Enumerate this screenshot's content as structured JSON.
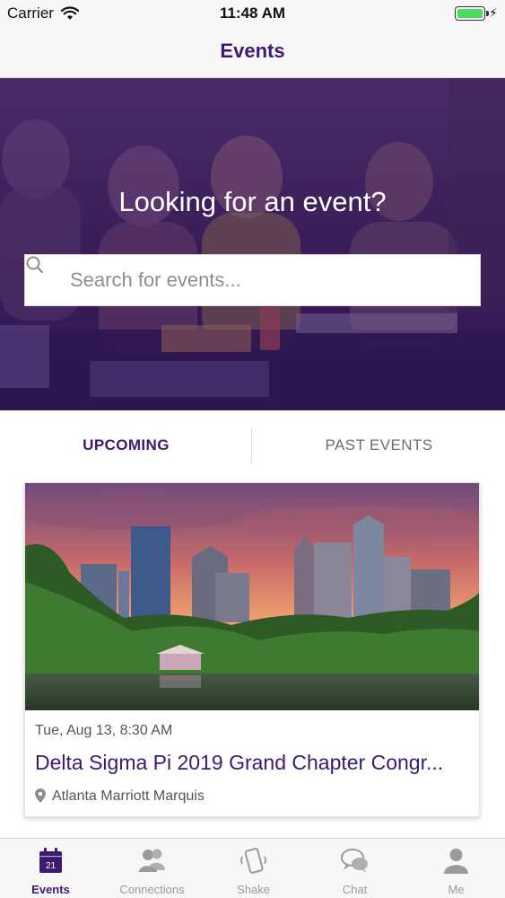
{
  "status_bar": {
    "carrier": "Carrier",
    "time": "11:48 AM",
    "battery_level": 1.0
  },
  "nav": {
    "title": "Events"
  },
  "hero": {
    "heading": "Looking for an event?"
  },
  "search": {
    "placeholder": "Search for events...",
    "value": ""
  },
  "tabs": [
    {
      "label": "UPCOMING",
      "active": true
    },
    {
      "label": "PAST EVENTS",
      "active": false
    }
  ],
  "events": [
    {
      "date": "Tue, Aug 13, 8:30 AM",
      "title": "Delta Sigma Pi 2019 Grand Chapter Congr...",
      "location": "Atlanta Marriott Marquis"
    }
  ],
  "tab_bar": {
    "calendar_day": "21",
    "items": [
      {
        "label": "Events",
        "icon": "calendar-icon",
        "active": true
      },
      {
        "label": "Connections",
        "icon": "people-icon",
        "active": false
      },
      {
        "label": "Shake",
        "icon": "phone-shake-icon",
        "active": false
      },
      {
        "label": "Chat",
        "icon": "chat-bubbles-icon",
        "active": false
      },
      {
        "label": "Me",
        "icon": "person-icon",
        "active": false
      }
    ]
  },
  "colors": {
    "brand": "#3d1a72",
    "inactive": "#9a9a9a",
    "battery": "#4cd964"
  }
}
